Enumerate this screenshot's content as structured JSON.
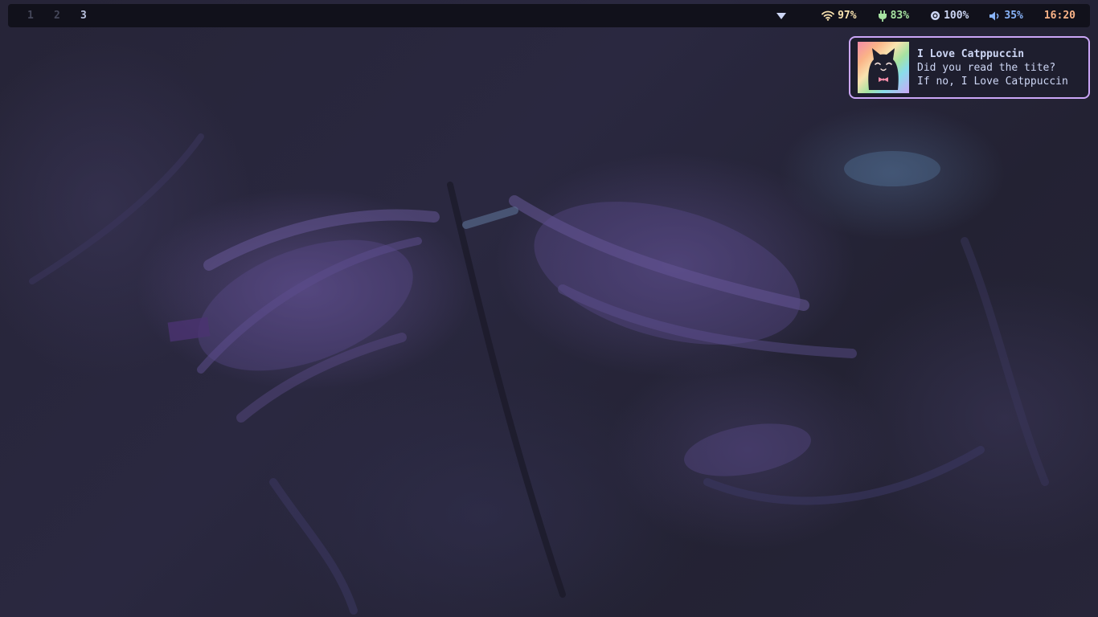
{
  "bar": {
    "workspaces": [
      {
        "label": "1",
        "active": false
      },
      {
        "label": "2",
        "active": false
      },
      {
        "label": "3",
        "active": true
      }
    ],
    "wifi": {
      "icon": "wifi-icon",
      "value": "97%"
    },
    "battery": {
      "icon": "plug-icon",
      "value": "83%"
    },
    "brightness": {
      "icon": "brightness-icon",
      "value": "100%"
    },
    "volume": {
      "icon": "volume-icon",
      "value": "35%"
    },
    "clock": "16:20"
  },
  "notification": {
    "title": "I Love Catppuccin",
    "line1": "Did you read the tite?",
    "line2": "If no, I Love Catppuccin",
    "border_color": "#cba6f7"
  },
  "colors": {
    "bar_bg": "#11111b",
    "wifi": "#f9e2af",
    "battery": "#a6e3a1",
    "brightness": "#cdd6f4",
    "volume": "#89b4fa",
    "clock": "#fab387"
  }
}
